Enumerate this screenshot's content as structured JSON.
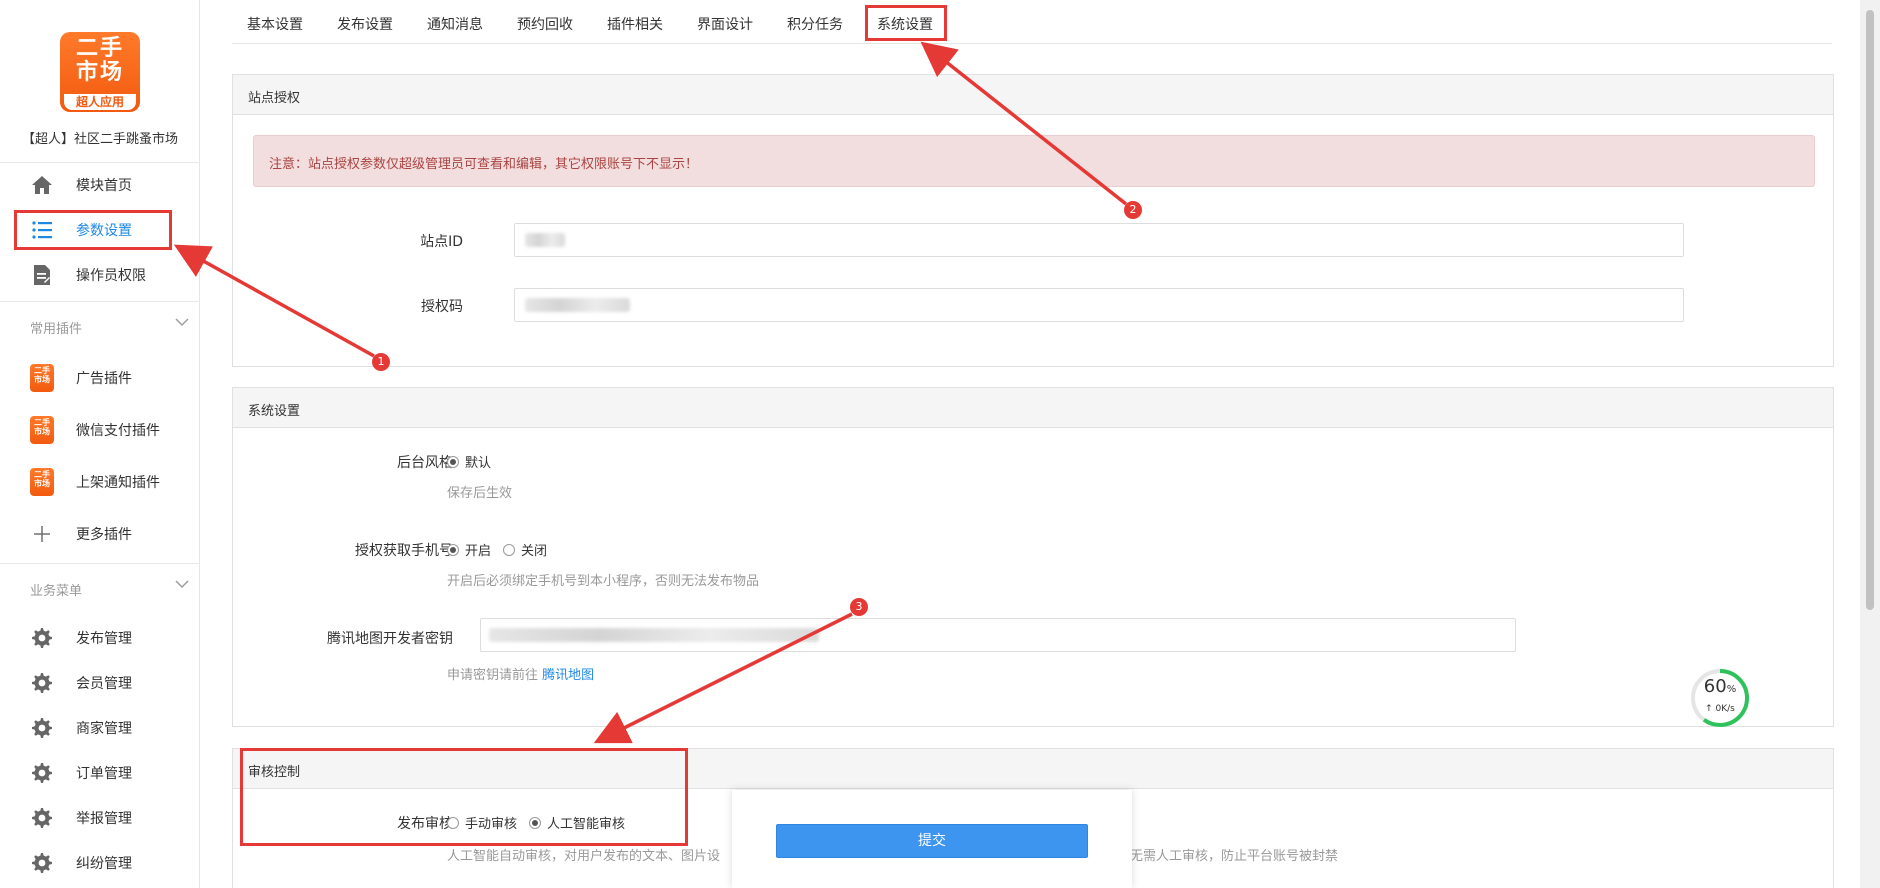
{
  "sidebar": {
    "logo": {
      "line1": "二手",
      "line2": "市场",
      "line3": "超人应用"
    },
    "app_name": "【超人】社区二手跳蚤市场",
    "top_items": [
      {
        "label": "模块首页",
        "icon": "home-icon"
      },
      {
        "label": "参数设置",
        "icon": "list-icon"
      },
      {
        "label": "操作员权限",
        "icon": "document-icon"
      }
    ],
    "group_plugins": {
      "title": "常用插件",
      "items": [
        {
          "label": "广告插件",
          "icon": "app-logo-icon"
        },
        {
          "label": "微信支付插件",
          "icon": "app-logo-icon"
        },
        {
          "label": "上架通知插件",
          "icon": "app-logo-icon"
        },
        {
          "label": "更多插件",
          "icon": "plus-icon"
        }
      ]
    },
    "group_business": {
      "title": "业务菜单",
      "items": [
        {
          "label": "发布管理",
          "icon": "gear-icon"
        },
        {
          "label": "会员管理",
          "icon": "gear-icon"
        },
        {
          "label": "商家管理",
          "icon": "gear-icon"
        },
        {
          "label": "订单管理",
          "icon": "gear-icon"
        },
        {
          "label": "举报管理",
          "icon": "gear-icon"
        },
        {
          "label": "纠纷管理",
          "icon": "gear-icon"
        }
      ]
    },
    "mini_logo": {
      "line1": "二手",
      "line2": "市场"
    }
  },
  "tabs": [
    "基本设置",
    "发布设置",
    "通知消息",
    "预约回收",
    "插件相关",
    "界面设计",
    "积分任务",
    "系统设置"
  ],
  "site_auth": {
    "title": "站点授权",
    "alert": "注意：站点授权参数仅超级管理员可查看和编辑，其它权限账号下不显示！",
    "site_id_label": "站点ID",
    "auth_code_label": "授权码"
  },
  "system": {
    "title": "系统设置",
    "style": {
      "label": "后台风格",
      "option": "默认",
      "help": "保存后生效"
    },
    "phone": {
      "label": "授权获取手机号",
      "options": [
        "开启",
        "关闭"
      ],
      "help": "开启后必须绑定手机号到本小程序，否则无法发布物品"
    },
    "map_key": {
      "label": "腾讯地图开发者密钥",
      "help_prefix": "申请密钥请前往",
      "help_link": "腾讯地图"
    }
  },
  "audit": {
    "title": "审核控制",
    "label": "发布审核",
    "options": [
      "手动审核",
      "人工智能审核"
    ],
    "help_left": "人工智能自动审核，对用户发布的文本、图片设",
    "help_right": "过无需人工审核，防止平台账号被封禁"
  },
  "submit_label": "提交",
  "speed": {
    "percent": "60",
    "unit": "%",
    "rate": "↑ 0K/s"
  },
  "annotations": [
    "1",
    "2",
    "3"
  ],
  "colors": {
    "accent": "#1e88e5",
    "annotation": "#e53935",
    "brand": "#f25a0f",
    "button": "#3d95f0"
  }
}
